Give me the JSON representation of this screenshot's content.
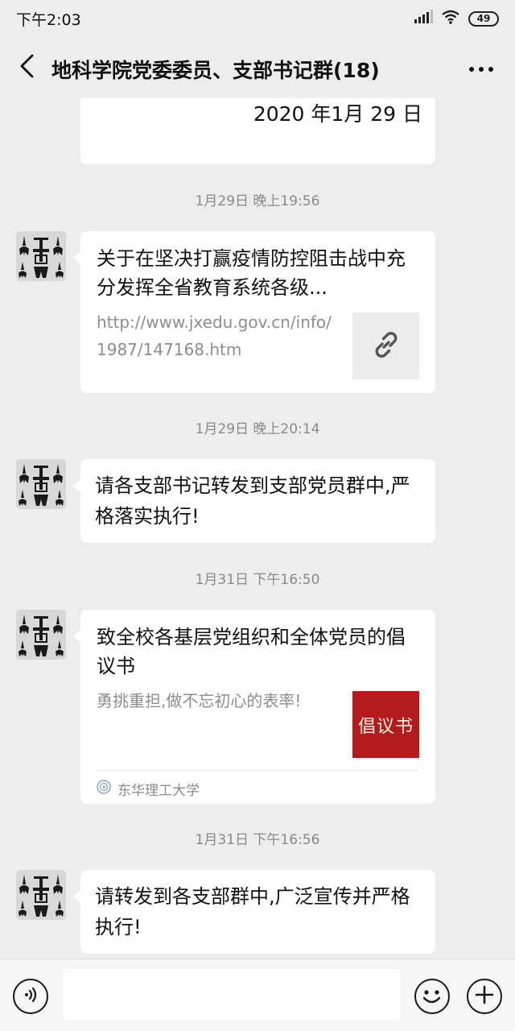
{
  "status_bar": {
    "time": "下午2:03",
    "battery": "49"
  },
  "header": {
    "title": "地科学院党委委员、支部书记群(18)"
  },
  "messages": {
    "prev_fragment": "2020 年1月 29 日",
    "ts1": "1月29日 晚上19:56",
    "link_card": {
      "title": "关于在坚决打赢疫情防控阻击战中充分发挥全省教育系统各级...",
      "url": "http://www.jxedu.gov.cn/info/1987/147168.htm",
      "icon": "link-icon"
    },
    "ts2": "1月29日 晚上20:14",
    "text1": "请各支部书记转发到支部党员群中,严格落实执行!",
    "ts3": "1月31日 下午16:50",
    "article_card": {
      "title": "致全校各基层党组织和全体党员的倡议书",
      "desc": "勇挑重担,做不忘初心的表率!",
      "thumb_text": "倡议书",
      "source": "东华理工大学",
      "thumb_color": "#b51a1c"
    },
    "ts4": "1月31日 下午16:56",
    "text2": "请转发到各支部群中,广泛宣传并严格执行!"
  },
  "colors": {
    "background": "#ededed",
    "bubble": "#ffffff",
    "timestamp": "#8a8a8a"
  }
}
